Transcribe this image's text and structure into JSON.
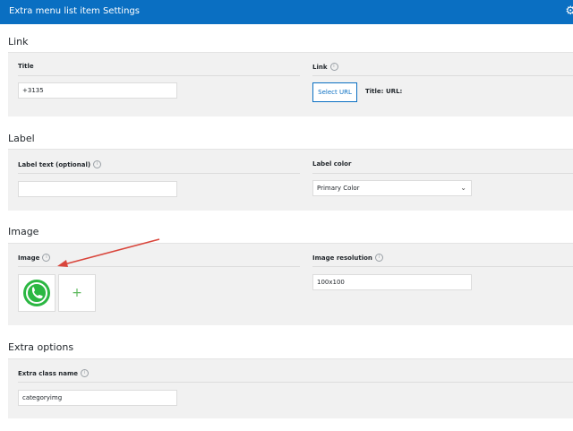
{
  "header": {
    "title": "Extra menu list item Settings",
    "icon": "gear-icon"
  },
  "sections": {
    "link": {
      "title": "Link",
      "title_label": "Title",
      "title_value": "+3135",
      "link_label": "Link",
      "select_url_label": "Select URL",
      "link_title_label": "Title:",
      "link_url_label": "URL:"
    },
    "label": {
      "title": "Label",
      "label_text_label": "Label text (optional)",
      "label_text_value": "",
      "label_color_label": "Label color",
      "label_color_value": "Primary Color"
    },
    "image": {
      "title": "Image",
      "image_label": "Image",
      "add_symbol": "+",
      "resolution_label": "Image resolution",
      "resolution_value": "100x100"
    },
    "extra": {
      "title": "Extra options",
      "class_label": "Extra class name",
      "class_value": "categoryimg"
    }
  },
  "colors": {
    "accent": "#0a6fc2",
    "panel": "#f1f1f1",
    "add": "#5cb85c",
    "annotation": "#d9453b"
  }
}
